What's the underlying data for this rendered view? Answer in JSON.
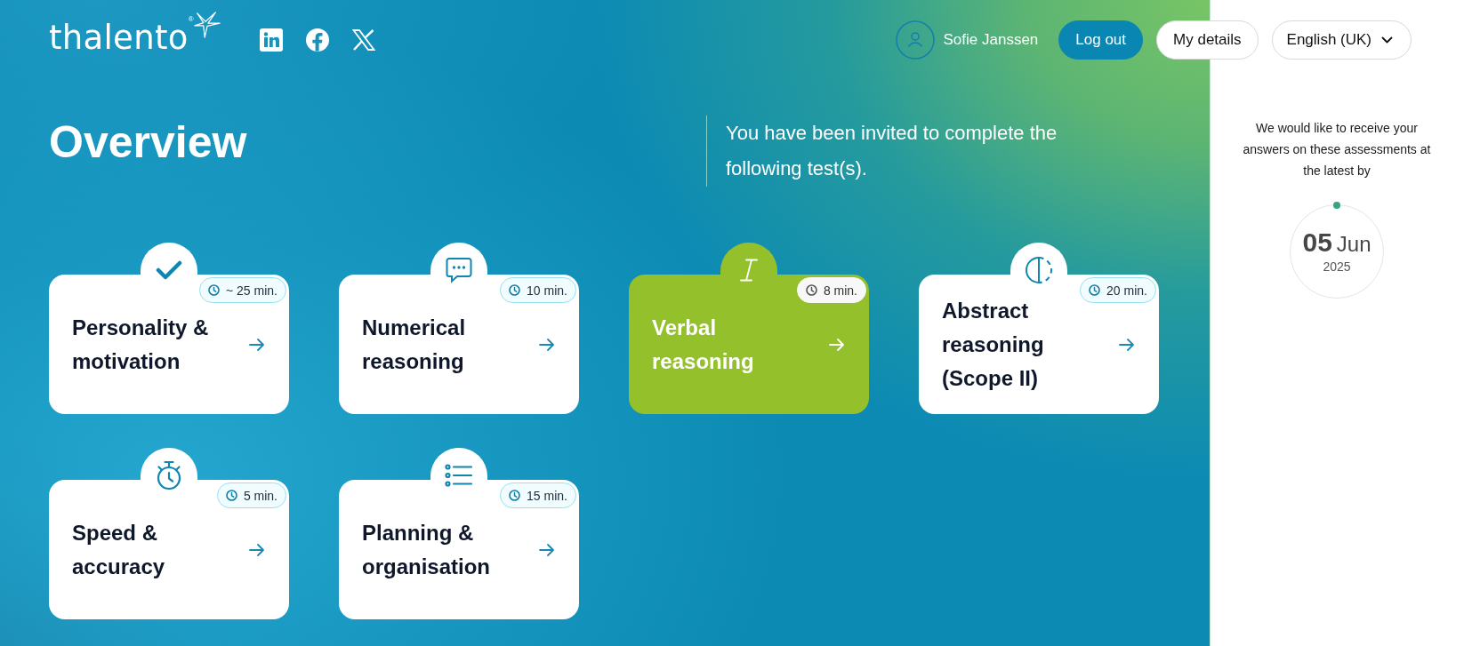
{
  "header": {
    "logo": {
      "text": "thalento",
      "mark": "®"
    },
    "social_links": [
      {
        "kind": "linkedin"
      },
      {
        "kind": "facebook"
      },
      {
        "kind": "x"
      }
    ],
    "user": {
      "name": "Sofie Janssen"
    },
    "buttons": [
      {
        "label": "Log out",
        "kind": "primary"
      },
      {
        "label": "My details",
        "kind": "secondary"
      }
    ],
    "language": {
      "label": "English (UK)"
    }
  },
  "overview": {
    "title": "Overview",
    "intro": "You have been invited to complete the following test(s)."
  },
  "tests": [
    {
      "kind": "personality",
      "title": "Personality & motivation",
      "duration": "~ 25 min.",
      "selected": false
    },
    {
      "kind": "numerical",
      "title": "Numerical reasoning",
      "duration": "10 min.",
      "selected": false
    },
    {
      "kind": "verbal",
      "title": "Verbal reasoning",
      "duration": "8 min.",
      "selected": true
    },
    {
      "kind": "abstract",
      "title": "Abstract reasoning (Scope II)",
      "duration": "20 min.",
      "selected": false
    },
    {
      "kind": "speed",
      "title": "Speed & accuracy",
      "duration": "5 min.",
      "selected": false
    },
    {
      "kind": "planning",
      "title": "Planning & organisation",
      "duration": "15 min.",
      "selected": false
    }
  ],
  "deadline": {
    "message": "We would like to receive your answers on these assessments at the latest by",
    "day": "05",
    "month": "Jun",
    "year": "2025"
  }
}
